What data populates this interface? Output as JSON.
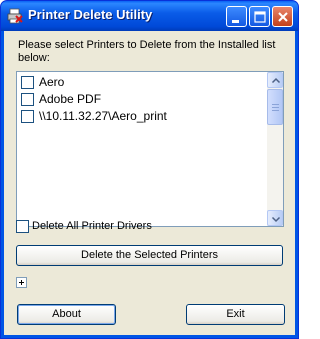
{
  "window": {
    "title": "Printer Delete Utility"
  },
  "prompt": "Please select Printers to Delete from the Installed list below:",
  "printers": [
    {
      "name": "Aero",
      "checked": false
    },
    {
      "name": "Adobe PDF",
      "checked": false
    },
    {
      "name": "\\\\10.11.32.27\\Aero_print",
      "checked": false
    }
  ],
  "delete_all": {
    "label": "Delete All Printer Drivers",
    "checked": false
  },
  "buttons": {
    "delete_selected": "Delete the Selected Printers",
    "about": "About",
    "exit": "Exit"
  },
  "icons": {
    "app": "printer-delete-icon",
    "expand": "plus-icon",
    "minimize": "minimize-icon",
    "maximize": "maximize-icon",
    "close": "close-icon"
  },
  "colors": {
    "titlebar": "#0055e5",
    "client": "#ece9d8",
    "button_border": "#003c74"
  }
}
